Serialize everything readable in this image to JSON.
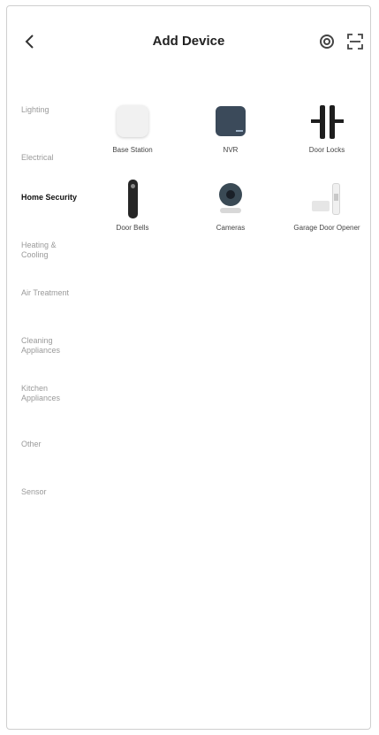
{
  "header": {
    "title": "Add Device",
    "back_icon": "chevron-left-icon",
    "scan_icon": "scan-icon",
    "qr_icon": "qr-scan-icon"
  },
  "sidebar": {
    "items": [
      {
        "label": "Lighting",
        "active": false
      },
      {
        "label": "Electrical",
        "active": false
      },
      {
        "label": "Home Security",
        "active": true
      },
      {
        "label": "Heating & Cooling",
        "active": false
      },
      {
        "label": "Air Treatment",
        "active": false
      },
      {
        "label": "Cleaning Appliances",
        "active": false
      },
      {
        "label": "Kitchen Appliances",
        "active": false
      },
      {
        "label": "Other",
        "active": false
      },
      {
        "label": "Sensor",
        "active": false
      }
    ]
  },
  "devices": [
    {
      "label": "Base Station",
      "icon": "base-station-icon"
    },
    {
      "label": "NVR",
      "icon": "nvr-icon"
    },
    {
      "label": "Door Locks",
      "icon": "door-lock-icon"
    },
    {
      "label": "Door Bells",
      "icon": "door-bell-icon"
    },
    {
      "label": "Cameras",
      "icon": "camera-icon"
    },
    {
      "label": "Garage Door Opener",
      "icon": "garage-door-opener-icon"
    }
  ]
}
